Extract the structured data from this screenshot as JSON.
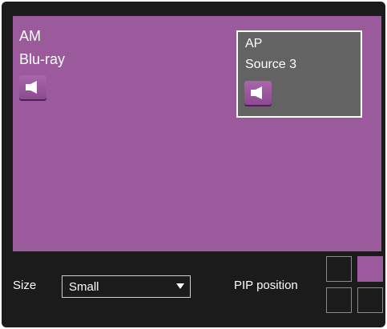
{
  "main": {
    "label_line1": "AM",
    "label_line2": "Blu-ray",
    "background_color": "#9b5a9b",
    "speaker_icon": "speaker-icon"
  },
  "pip": {
    "label_line1": "AP",
    "label_line2": "Source 3",
    "background_color": "#636363",
    "border_color": "#ffffff",
    "speaker_icon": "speaker-icon"
  },
  "controls": {
    "size_label": "Size",
    "size_value": "Small",
    "pip_position_label": "PIP position",
    "pip_position_selected": "top-right",
    "positions": [
      "top-left",
      "top-right",
      "bottom-left",
      "bottom-right"
    ]
  },
  "colors": {
    "accent": "#9b5a9b",
    "frame": "#1b1b1b",
    "text": "#ffffff"
  }
}
